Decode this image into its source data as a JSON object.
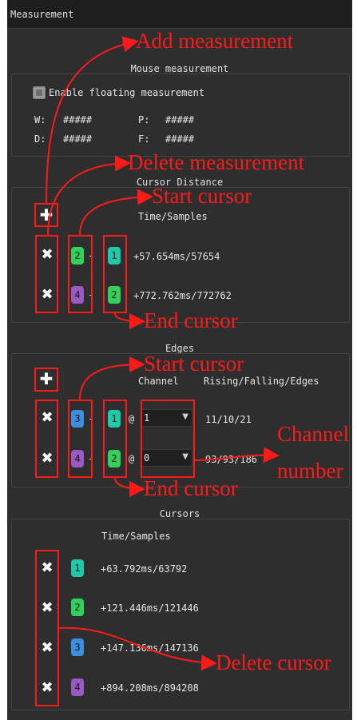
{
  "window": {
    "title": "Measurement"
  },
  "mouse": {
    "title": "Mouse measurement",
    "enable_label": "Enable floating measurement",
    "w_label": "W:",
    "w_value": "#####",
    "p_label": "P:",
    "p_value": "#####",
    "d_label": "D:",
    "d_value": "#####",
    "f_label": "F:",
    "f_value": "#####"
  },
  "cursor_distance": {
    "title": "Cursor Distance",
    "column_header": "Time/Samples",
    "rows": [
      {
        "start": "2",
        "end": "1",
        "value": "+57.654ms/57654"
      },
      {
        "start": "4",
        "end": "2",
        "value": "+772.762ms/772762"
      }
    ]
  },
  "edges": {
    "title": "Edges",
    "header_channel": "Channel",
    "header_counts": "Rising/Falling/Edges",
    "rows": [
      {
        "start": "3",
        "end": "1",
        "at": "@",
        "channel": "1",
        "counts": "11/10/21"
      },
      {
        "start": "4",
        "end": "2",
        "at": "@",
        "channel": "0",
        "counts": "93/93/186"
      }
    ]
  },
  "cursors": {
    "title": "Cursors",
    "column_header": "Time/Samples",
    "rows": [
      {
        "id": "1",
        "value": "+63.792ms/63792"
      },
      {
        "id": "2",
        "value": "+121.446ms/121446"
      },
      {
        "id": "3",
        "value": "+147.136ms/147136"
      },
      {
        "id": "4",
        "value": "+894.208ms/894208"
      }
    ]
  },
  "annotations": {
    "add_measurement": "Add measurement",
    "delete_measurement": "Delete measurement",
    "start_cursor_1": "Start cursor",
    "end_cursor_1": "End cursor",
    "start_cursor_2": "Start cursor",
    "channel_number_line1": "Channel",
    "channel_number_line2": "number",
    "end_cursor_2": "End cursor",
    "delete_cursor": "Delete cursor"
  },
  "colors": {
    "cursor_1": "#1ec8a8",
    "cursor_2": "#32d25a",
    "cursor_3": "#3a8fe0",
    "cursor_4": "#9b59c4",
    "annotation": "#ff1a1a",
    "panel_bg": "#2e2e2e"
  }
}
